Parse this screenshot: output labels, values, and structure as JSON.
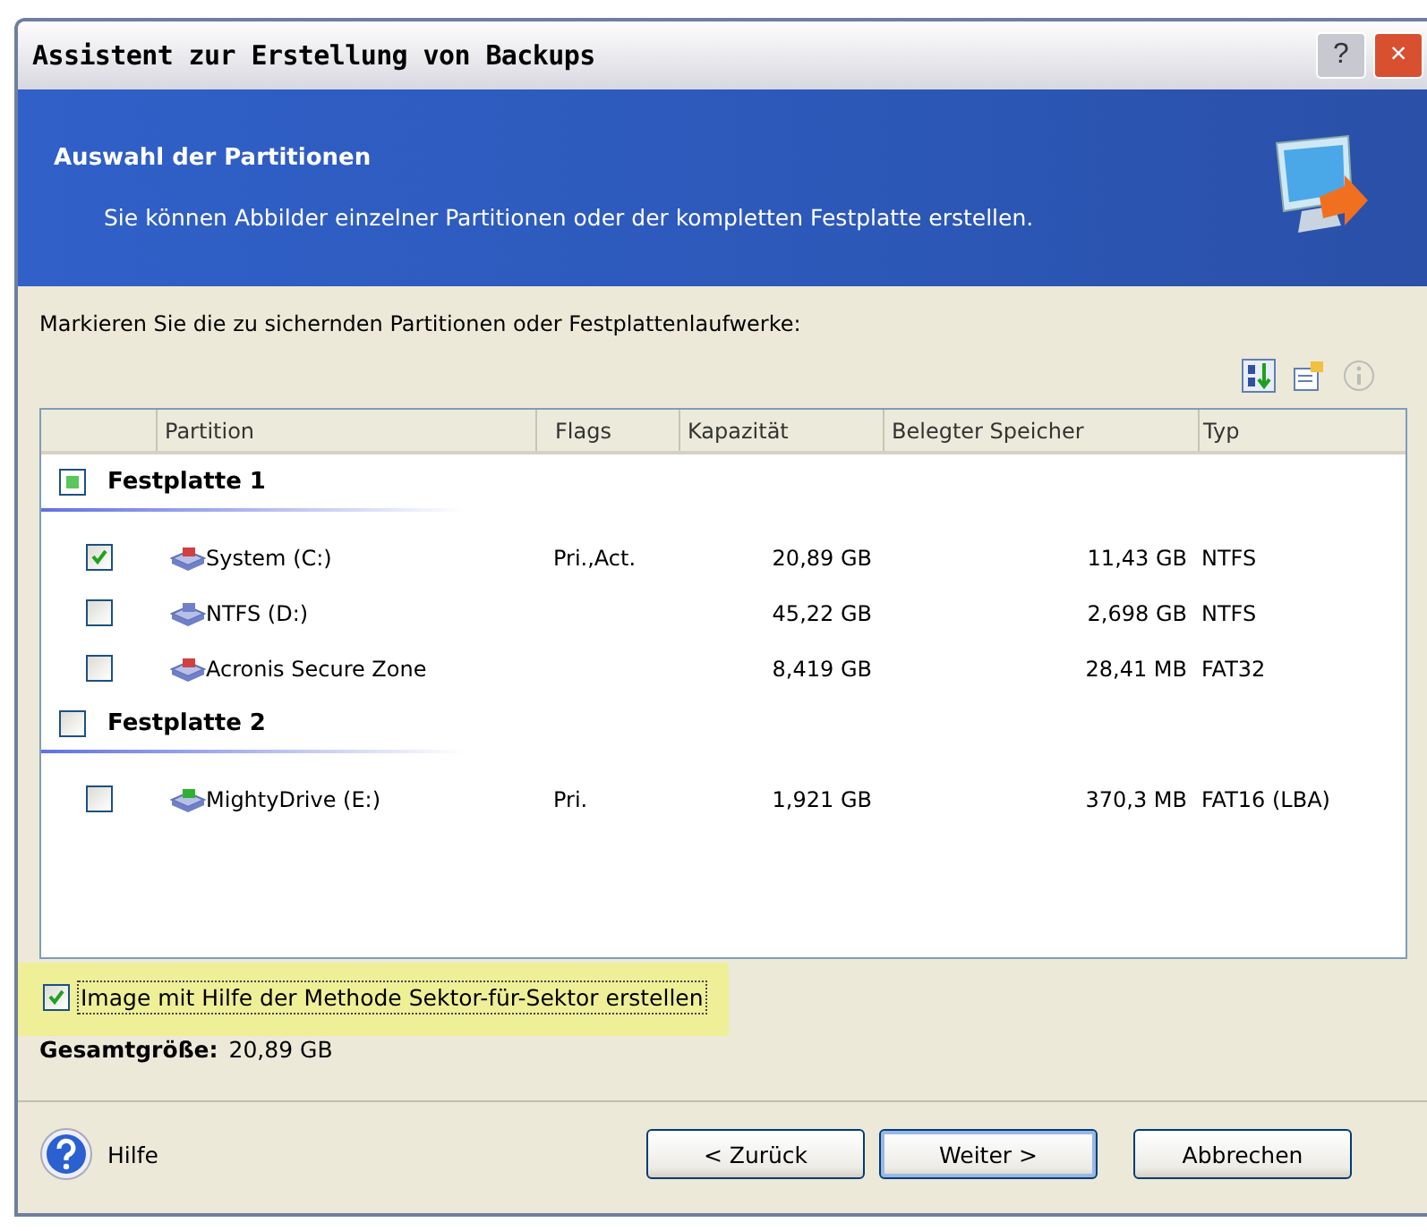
{
  "window": {
    "title": "Assistent zur Erstellung von Backups",
    "buttons": [
      "?",
      "×"
    ]
  },
  "header": {
    "title": "Auswahl der Partitionen",
    "subtitle": "Sie können Abbilder einzelner Partitionen oder der kompletten Festplatte erstellen."
  },
  "instruction": "Markieren Sie die zu sichernden Partitionen oder Festplattenlaufwerke:",
  "table": {
    "columns": [
      "Partition",
      "Flags",
      "Kapazität",
      "Belegter Speicher",
      "Typ"
    ],
    "disks": [
      {
        "name": "Festplatte 1",
        "checked": false,
        "partial": true,
        "partitions": [
          {
            "name": "System (C:)",
            "flags": "Pri.,Act.",
            "capacity": "20,89 GB",
            "used": "11,43 GB",
            "type": "NTFS",
            "checked": true,
            "color": "#d04040"
          },
          {
            "name": "NTFS (D:)",
            "capacity": "45,22 GB",
            "used": "2,698 GB",
            "type": "NTFS",
            "checked": false,
            "color": "#7080c8"
          },
          {
            "name": "Acronis Secure Zone",
            "capacity": "8,419 GB",
            "used": "28,41 MB",
            "type": "FAT32",
            "checked": false,
            "color": "#d04040"
          }
        ]
      },
      {
        "name": "Festplatte 2",
        "checked": false,
        "partial": false,
        "partitions": [
          {
            "name": "MightyDrive (E:)",
            "flags": "Pri.",
            "capacity": "1,921 GB",
            "used": "370,3 MB",
            "type": "FAT16 (LBA)",
            "checked": false,
            "color": "#30b030"
          }
        ]
      }
    ]
  },
  "sector_option": {
    "label": "Image mit Hilfe der Methode Sektor-für-Sektor erstellen",
    "checked": true,
    "highlighted": true
  },
  "total": {
    "label": "Gesamtgröße:",
    "value": "20,89 GB"
  },
  "help": "Hilfe",
  "buttons": [
    {
      "label": "< Zurück",
      "default": false
    },
    {
      "label": "Weiter >",
      "default": true
    },
    {
      "label": "Abbrechen",
      "default": false
    }
  ]
}
